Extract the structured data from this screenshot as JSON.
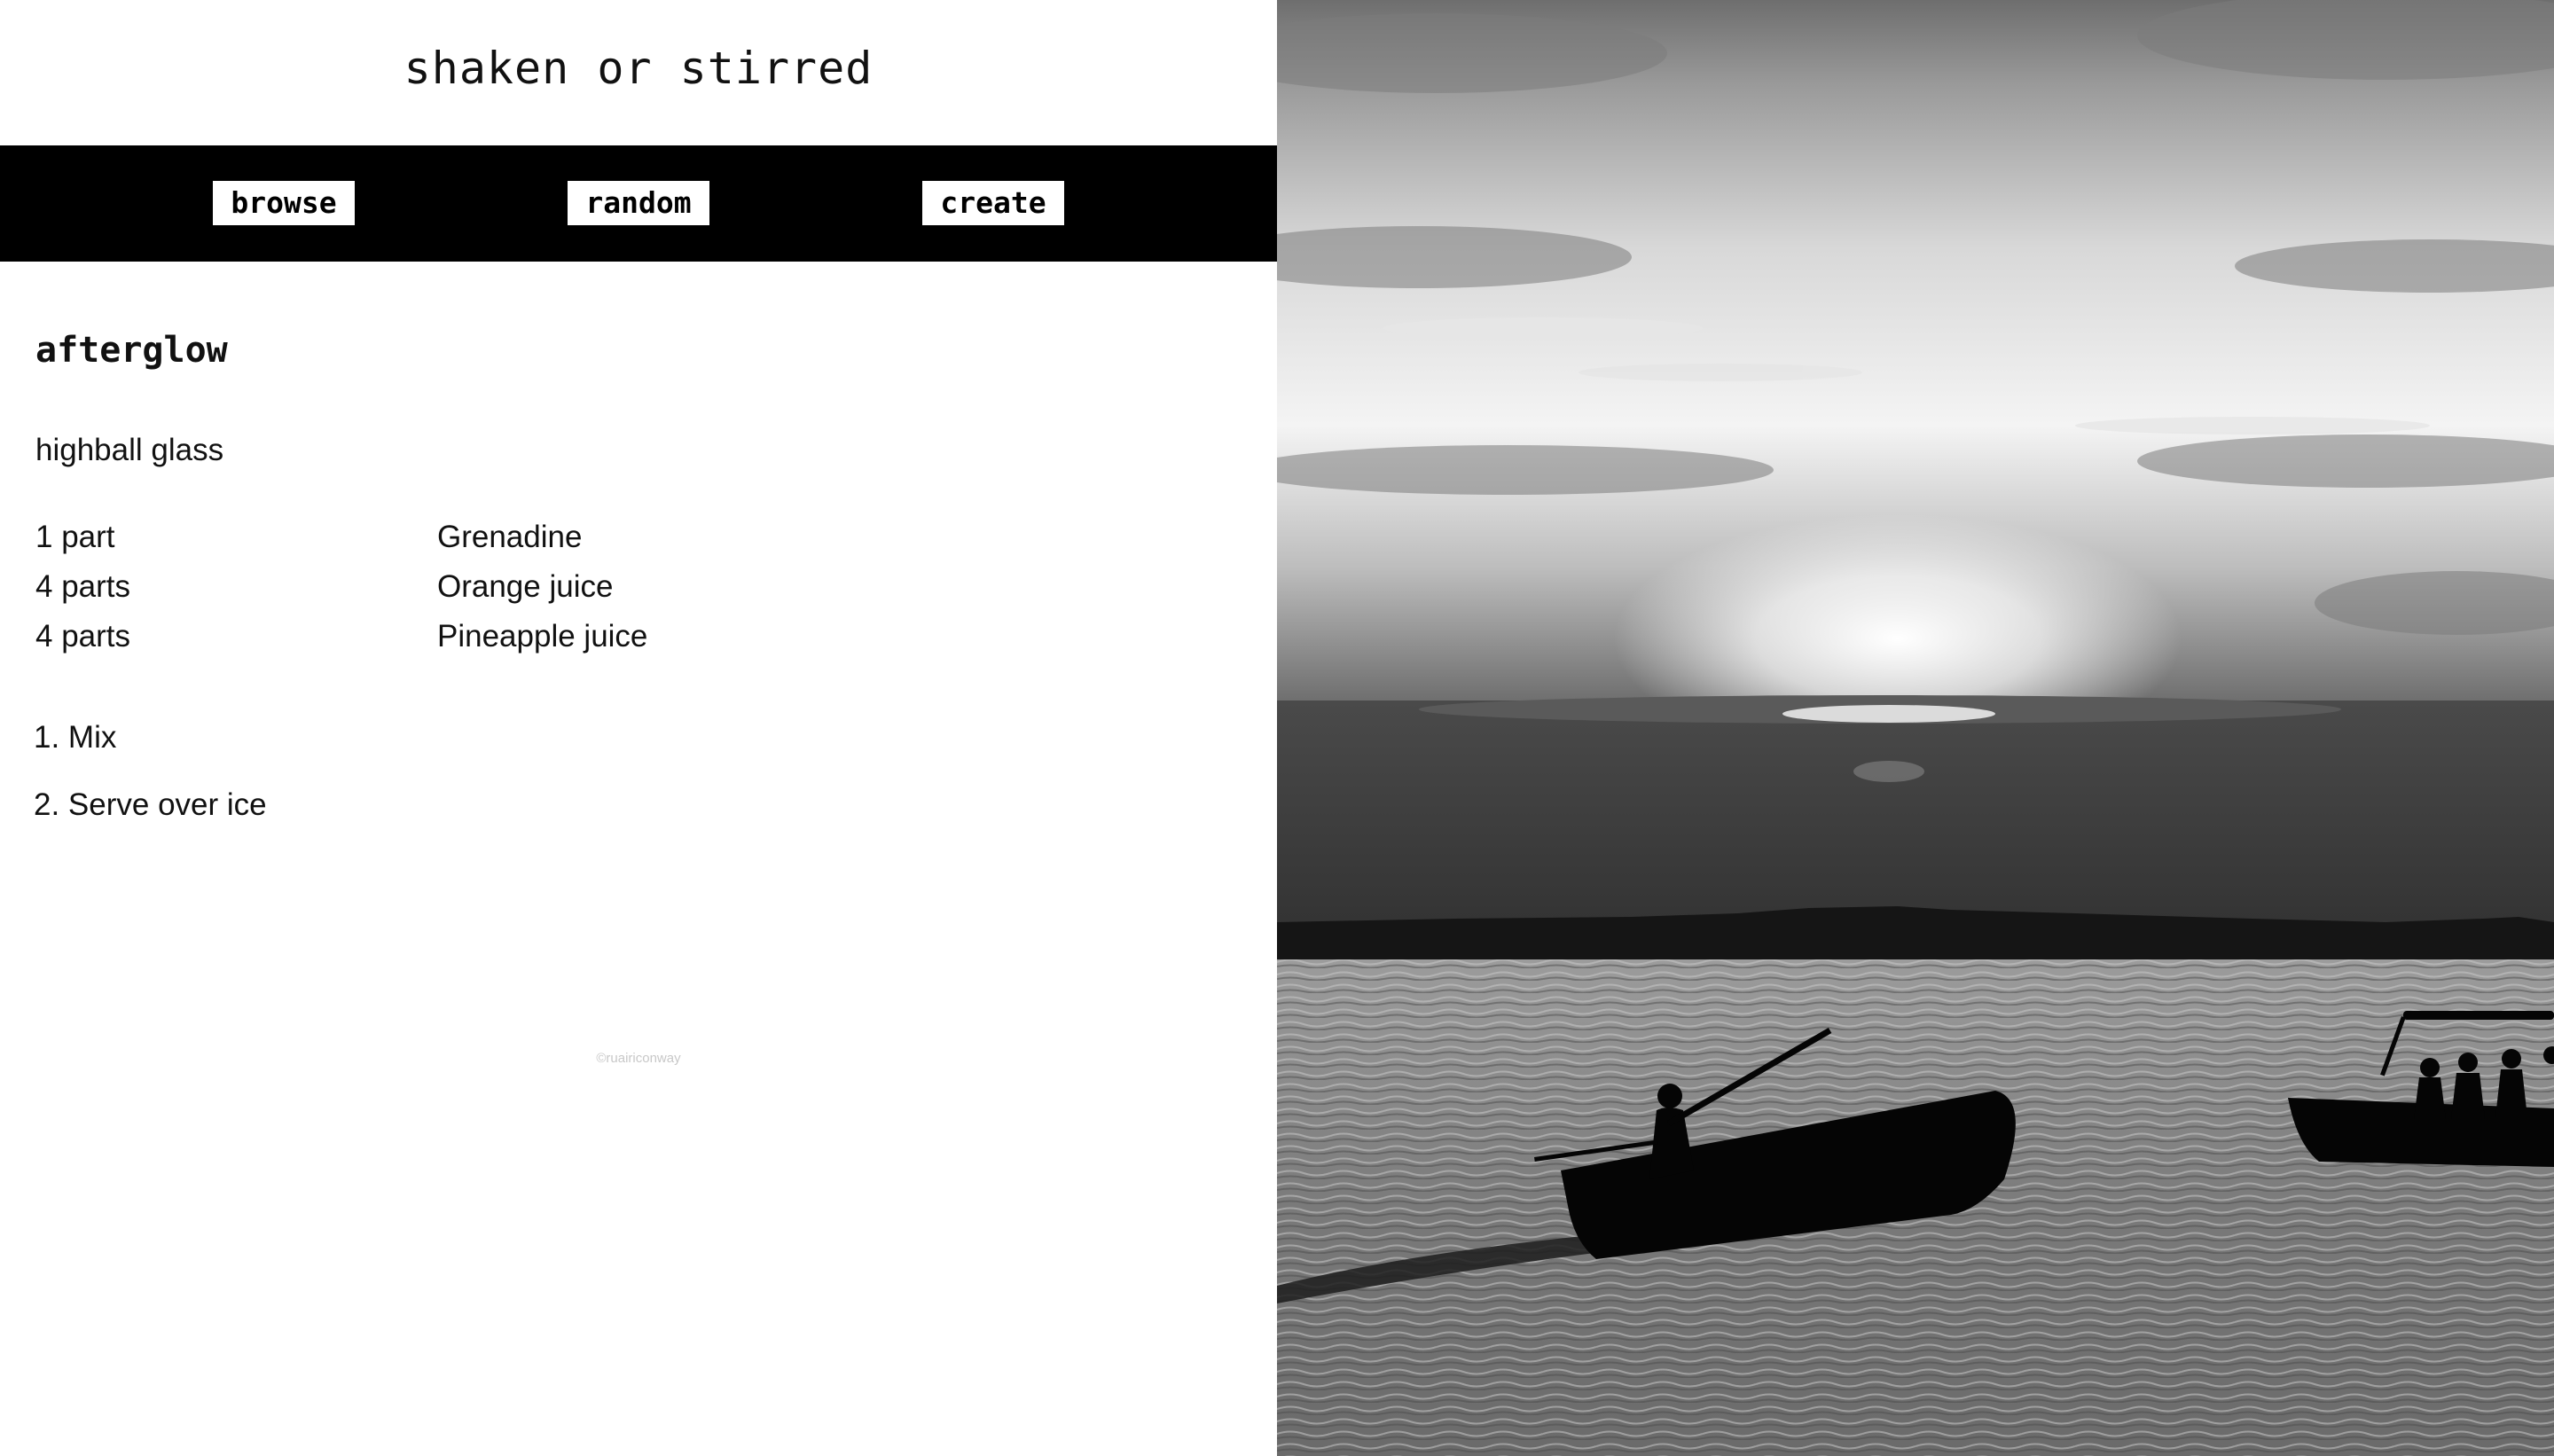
{
  "site": {
    "title": "shaken or stirred"
  },
  "nav": {
    "items": [
      {
        "label": "browse"
      },
      {
        "label": "random"
      },
      {
        "label": "create"
      }
    ]
  },
  "drink": {
    "name": "afterglow",
    "glass": "highball glass",
    "ingredients": [
      {
        "amount": "1 part",
        "name": "Grenadine"
      },
      {
        "amount": "4 parts",
        "name": "Orange juice"
      },
      {
        "amount": "4 parts",
        "name": "Pineapple juice"
      }
    ],
    "steps": [
      {
        "text": "1. Mix"
      },
      {
        "text": "2. Serve over ice"
      }
    ]
  },
  "footer": {
    "credit": "©ruairiconway"
  },
  "photo": {
    "icon": "sunset-lake-boats-photo",
    "palette": [
      "#ffffff",
      "#bdbdbd",
      "#5a5a5a",
      "#3a3a3a",
      "#000000"
    ]
  }
}
